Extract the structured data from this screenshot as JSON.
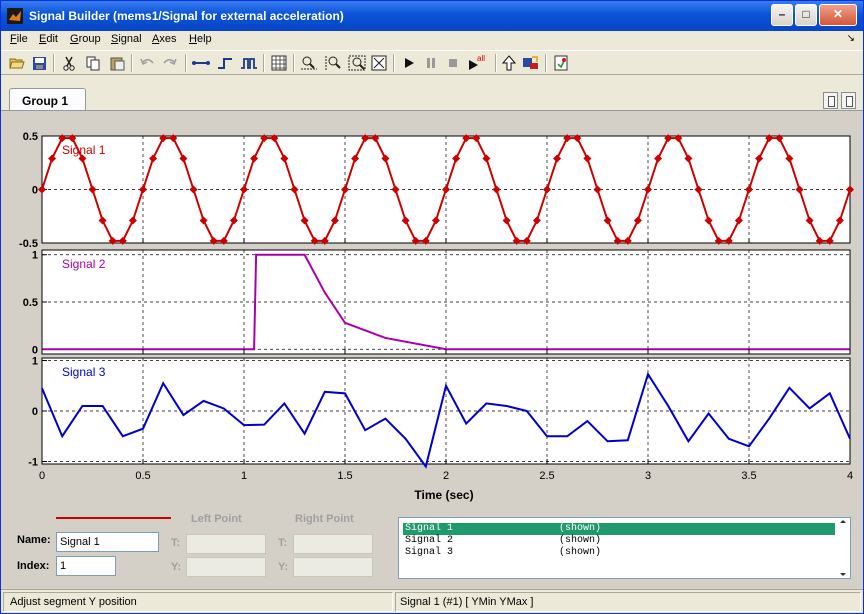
{
  "window": {
    "title": "Signal Builder (mems1/Signal for external  acceleration)"
  },
  "menu": [
    {
      "label": "File",
      "accel": "F",
      "rest": "ile"
    },
    {
      "label": "Edit",
      "accel": "E",
      "rest": "dit"
    },
    {
      "label": "Group",
      "accel": "G",
      "rest": "roup"
    },
    {
      "label": "Signal",
      "accel": "S",
      "rest": "ignal"
    },
    {
      "label": "Axes",
      "accel": "A",
      "rest": "xes"
    },
    {
      "label": "Help",
      "accel": "H",
      "rest": "elp"
    }
  ],
  "toolbar": {
    "icons": [
      "open-icon",
      "save-icon",
      "cut-icon",
      "copy-icon",
      "paste-icon",
      "undo-icon",
      "redo-icon",
      "segment-icon",
      "step-up-icon",
      "pulse-icon",
      "snap-grid-icon",
      "zoom-x-icon",
      "zoom-y-icon",
      "zoom-xy-icon",
      "full-view-icon",
      "play-icon",
      "pause-icon",
      "stop-icon",
      "play-all-icon",
      "up-to-model-icon",
      "show-block-icon",
      "help-icon"
    ],
    "play_all_badge": "all"
  },
  "tabs": [
    {
      "label": "Group 1"
    }
  ],
  "axes": {
    "xlabel": "Time (sec)",
    "xticks": [
      "0",
      "0.5",
      "1",
      "1.5",
      "2",
      "2.5",
      "3",
      "3.5",
      "4"
    ],
    "signal1_yticks": [
      "0.5",
      "0",
      "-0.5"
    ],
    "signal2_yticks": [
      "1",
      "0.5",
      "0"
    ],
    "signal3_yticks": [
      "1",
      "0",
      "-1"
    ]
  },
  "chart_data": [
    {
      "type": "line",
      "name": "Signal 1",
      "color": "#cc0000",
      "xlim": [
        0,
        4
      ],
      "ylim": [
        -0.5,
        0.5
      ],
      "x": [
        0,
        0.05,
        0.1,
        0.15,
        0.2,
        0.25,
        0.3,
        0.35,
        0.4,
        0.45,
        0.5,
        0.55,
        0.6,
        0.65,
        0.7,
        0.75,
        0.8,
        0.85,
        0.9,
        0.95,
        1,
        1.05,
        1.1,
        1.15,
        1.2,
        1.25,
        1.3,
        1.35,
        1.4,
        1.45,
        1.5,
        1.55,
        1.6,
        1.65,
        1.7,
        1.75,
        1.8,
        1.85,
        1.9,
        1.95,
        2,
        2.05,
        2.1,
        2.15,
        2.2,
        2.25,
        2.3,
        2.35,
        2.4,
        2.45,
        2.5,
        2.55,
        2.6,
        2.65,
        2.7,
        2.75,
        2.8,
        2.85,
        2.9,
        2.95,
        3,
        3.05,
        3.1,
        3.15,
        3.2,
        3.25,
        3.3,
        3.35,
        3.4,
        3.45,
        3.5,
        3.55,
        3.6,
        3.65,
        3.7,
        3.75,
        3.8,
        3.85,
        3.9,
        3.95,
        4
      ],
      "y": [
        0,
        0.29,
        0.48,
        0.48,
        0.29,
        0,
        -0.29,
        -0.48,
        -0.48,
        -0.29,
        0,
        0.29,
        0.48,
        0.48,
        0.29,
        0,
        -0.29,
        -0.48,
        -0.48,
        -0.29,
        0,
        0.29,
        0.48,
        0.48,
        0.29,
        0,
        -0.29,
        -0.48,
        -0.48,
        -0.29,
        0,
        0.29,
        0.48,
        0.48,
        0.29,
        0,
        -0.29,
        -0.48,
        -0.48,
        -0.29,
        0,
        0.29,
        0.48,
        0.48,
        0.29,
        0,
        -0.29,
        -0.48,
        -0.48,
        -0.29,
        0,
        0.29,
        0.48,
        0.48,
        0.29,
        0,
        -0.29,
        -0.48,
        -0.48,
        -0.29,
        0,
        0.29,
        0.48,
        0.48,
        0.29,
        0,
        -0.29,
        -0.48,
        -0.48,
        -0.29,
        0,
        0.29,
        0.48,
        0.48,
        0.29,
        0,
        -0.29,
        -0.48,
        -0.48,
        -0.29,
        0
      ]
    },
    {
      "type": "line",
      "name": "Signal 2",
      "color": "#aa00aa",
      "xlim": [
        0,
        4
      ],
      "ylim": [
        -0.05,
        1.05
      ],
      "x": [
        0,
        1.05,
        1.06,
        1.3,
        1.4,
        1.5,
        1.7,
        2.0,
        4.0
      ],
      "y": [
        0,
        0,
        1,
        1,
        0.6,
        0.28,
        0.12,
        0,
        0
      ]
    },
    {
      "type": "line",
      "name": "Signal 3",
      "color": "#0000cc",
      "xlim": [
        0,
        4
      ],
      "ylim": [
        -1.05,
        1.05
      ],
      "x": [
        0,
        0.1,
        0.2,
        0.3,
        0.4,
        0.5,
        0.6,
        0.7,
        0.8,
        0.9,
        1.0,
        1.1,
        1.2,
        1.3,
        1.4,
        1.5,
        1.6,
        1.7,
        1.8,
        1.9,
        2.0,
        2.1,
        2.2,
        2.3,
        2.4,
        2.5,
        2.6,
        2.7,
        2.8,
        2.9,
        3.0,
        3.1,
        3.2,
        3.3,
        3.4,
        3.5,
        3.6,
        3.7,
        3.8,
        3.9,
        4.0
      ],
      "y": [
        0.45,
        -0.5,
        0.1,
        0.1,
        -0.5,
        -0.35,
        0.55,
        -0.08,
        0.2,
        0.05,
        -0.28,
        -0.27,
        0.15,
        -0.45,
        0.38,
        0.35,
        -0.38,
        -0.15,
        -0.55,
        -1.1,
        0.5,
        -0.25,
        0.15,
        0.1,
        0.0,
        -0.5,
        -0.5,
        -0.2,
        -0.6,
        -0.58,
        0.73,
        0.1,
        -0.6,
        -0.05,
        -0.55,
        -0.7,
        -0.15,
        0.46,
        0.05,
        0.35,
        -0.55
      ]
    }
  ],
  "editor": {
    "left_point": "Left Point",
    "right_point": "Right Point",
    "name_label": "Name:",
    "name_value": "Signal 1",
    "index_label": "Index:",
    "index_value": "1",
    "t_label": "T:",
    "y_label": "Y:"
  },
  "signal_list": [
    {
      "name": "Signal 1",
      "state": "(shown)"
    },
    {
      "name": "Signal 2",
      "state": "(shown)"
    },
    {
      "name": "Signal 3",
      "state": "(shown)"
    }
  ],
  "status": {
    "left": "Adjust segment Y position",
    "right": "Signal 1 (#1)  [ YMin YMax ]"
  }
}
